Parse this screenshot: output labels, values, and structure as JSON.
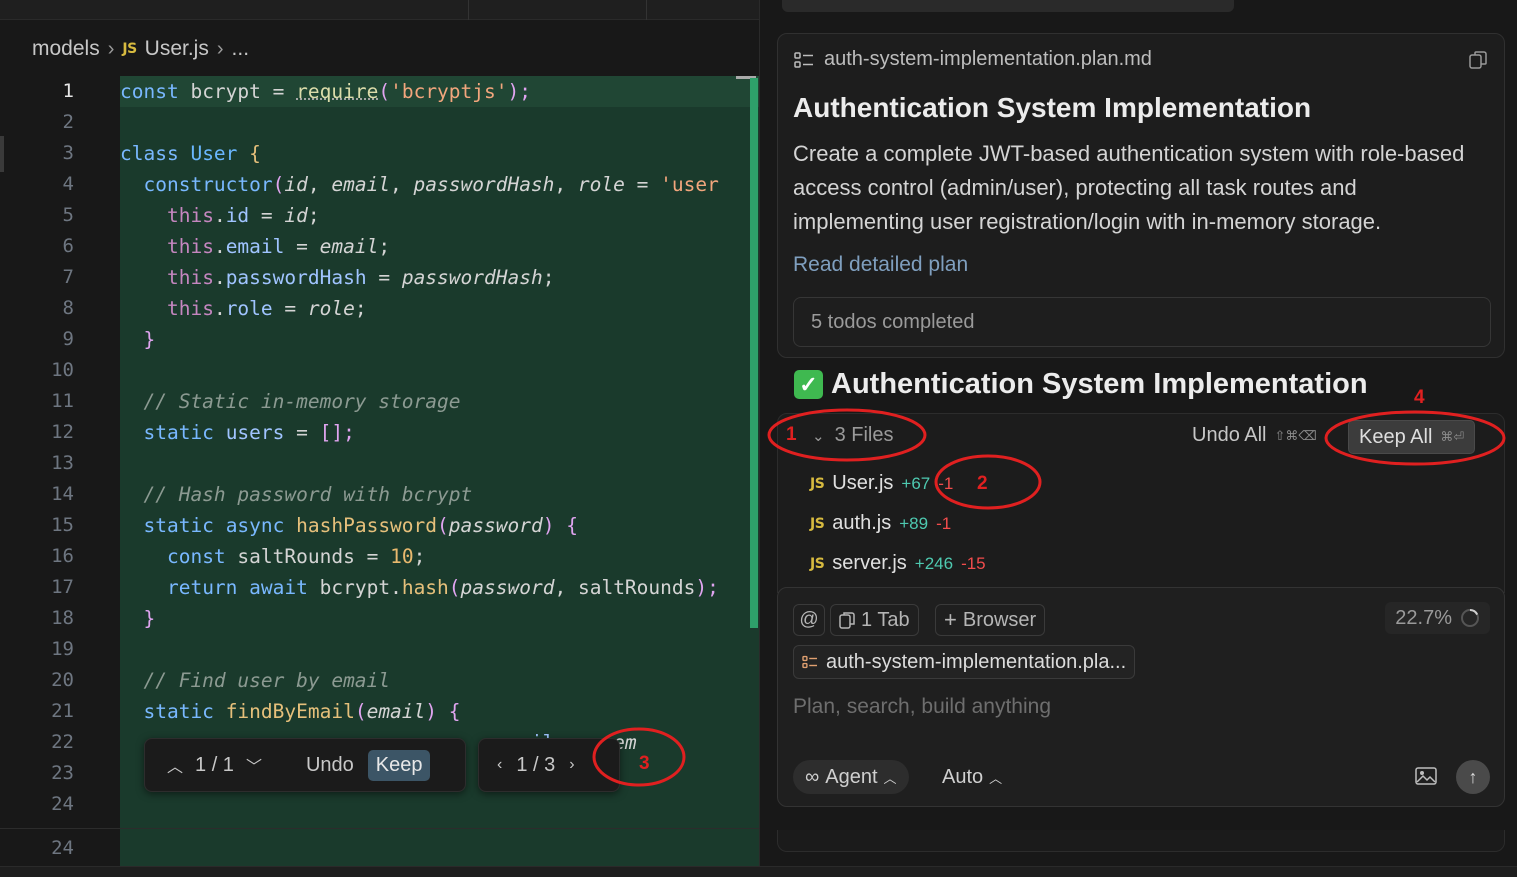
{
  "editor": {
    "breadcrumb": {
      "folder": "models",
      "file_icon": "JS",
      "file": "User.js",
      "more": "..."
    },
    "line_numbers": [
      "1",
      "2",
      "3",
      "4",
      "5",
      "6",
      "7",
      "8",
      "9",
      "10",
      "11",
      "12",
      "13",
      "14",
      "15",
      "16",
      "17",
      "18",
      "19",
      "20",
      "21",
      "22",
      "23",
      "24"
    ],
    "bottom_line_number": "24",
    "code": {
      "l1": [
        "const",
        "bcrypt",
        "=",
        "require",
        "(",
        "'bcryptjs'",
        ");"
      ],
      "l3": [
        "class",
        "User",
        "{"
      ],
      "l4": [
        "constructor",
        "(",
        "id",
        "email",
        "passwordHash",
        "role",
        "=",
        "'user"
      ],
      "l5": [
        "this",
        ".",
        "id",
        "=",
        "id",
        ";"
      ],
      "l6": [
        "this",
        ".",
        "email",
        "=",
        "email",
        ";"
      ],
      "l7": [
        "this",
        ".",
        "passwordHash",
        "=",
        "passwordHash",
        ";"
      ],
      "l8": [
        "this",
        ".",
        "role",
        "=",
        "role",
        ";"
      ],
      "l9": "}",
      "l11": "// Static in-memory storage",
      "l12": [
        "static",
        "users",
        "=",
        "[];"
      ],
      "l14": "// Hash password with bcrypt",
      "l15": [
        "static",
        "async",
        "hashPassword",
        "(",
        "password",
        ")",
        "{"
      ],
      "l16": [
        "const",
        "saltRounds",
        "=",
        "10",
        ";"
      ],
      "l17": [
        "return",
        "await",
        "bcrypt",
        ".",
        "hash",
        "(",
        "password",
        ",",
        "saltRounds",
        ");"
      ],
      "l18": "}",
      "l20": "// Find user by email",
      "l21": [
        "static",
        "findByEmail",
        "(",
        "email",
        ")",
        "{"
      ],
      "l22": [
        "email",
        "===",
        "em"
      ]
    },
    "review_bar": {
      "counter": "1 / 1",
      "undo": "Undo",
      "keep": "Keep"
    },
    "nav_bar": {
      "counter": "1 / 3"
    }
  },
  "annotations": [
    "1",
    "2",
    "3",
    "4"
  ],
  "annotation_color": "#e02020",
  "chat": {
    "plan_file": "auth-system-implementation.plan.md",
    "plan_title": "Authentication System Implementation",
    "plan_description": "Create a complete JWT-based authentication system with role-based access control (admin/user), protecting all task routes and implementing user registration/login with in-memory storage.",
    "read_link": "Read detailed plan",
    "todos": "5 todos completed",
    "done_heading": "Authentication System Implementation",
    "files_summary": "3 Files",
    "undo_all": "Undo All",
    "undo_all_shortcut": "⇧⌘⌫",
    "keep_all": "Keep All",
    "keep_all_shortcut": "⌘⏎",
    "files": [
      {
        "icon": "JS",
        "name": "User.js",
        "added": "+67",
        "removed": "-1"
      },
      {
        "icon": "JS",
        "name": "auth.js",
        "added": "+89",
        "removed": "-1"
      },
      {
        "icon": "JS",
        "name": "server.js",
        "added": "+246",
        "removed": "-15"
      }
    ],
    "composer": {
      "at": "@",
      "tab_chip": "1 Tab",
      "browser_chip": "Browser",
      "context_pct": "22.7%",
      "attached_file": "auth-system-implementation.pla...",
      "placeholder": "Plan, search, build anything",
      "mode": "Agent",
      "model": "Auto"
    }
  }
}
